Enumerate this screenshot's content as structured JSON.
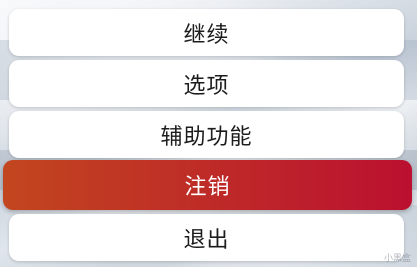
{
  "menu": {
    "items": [
      {
        "label": "继续"
      },
      {
        "label": "选项"
      },
      {
        "label": "辅助功能"
      },
      {
        "label": "注销",
        "highlighted": true
      },
      {
        "label": "退出"
      }
    ],
    "highlight_gradient": [
      "#c2461f",
      "#bb1030"
    ]
  },
  "watermark": {
    "text": "小黑盒"
  }
}
